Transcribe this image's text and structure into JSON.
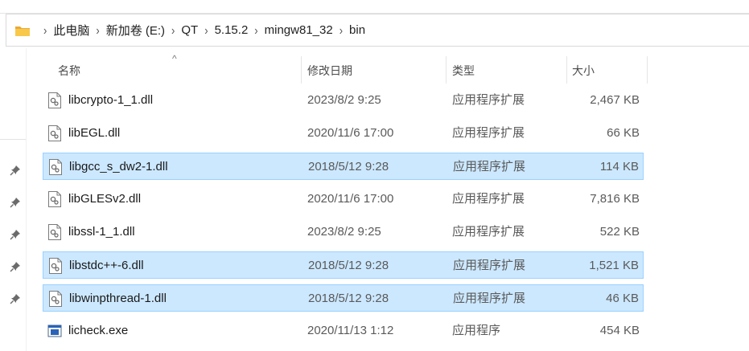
{
  "breadcrumb": [
    "此电脑",
    "新加卷 (E:)",
    "QT",
    "5.15.2",
    "mingw81_32",
    "bin"
  ],
  "columns": {
    "name": "名称",
    "date": "修改日期",
    "type": "类型",
    "size": "大小"
  },
  "files": [
    {
      "name": "libcrypto-1_1.dll",
      "date": "2023/8/2 9:25",
      "type": "应用程序扩展",
      "size": "2,467 KB",
      "icon": "dll-file-icon",
      "selected": false
    },
    {
      "name": "libEGL.dll",
      "date": "2020/11/6 17:00",
      "type": "应用程序扩展",
      "size": "66 KB",
      "icon": "dll-file-icon",
      "selected": false
    },
    {
      "name": "libgcc_s_dw2-1.dll",
      "date": "2018/5/12 9:28",
      "type": "应用程序扩展",
      "size": "114 KB",
      "icon": "dll-file-icon",
      "selected": true
    },
    {
      "name": "libGLESv2.dll",
      "date": "2020/11/6 17:00",
      "type": "应用程序扩展",
      "size": "7,816 KB",
      "icon": "dll-file-icon",
      "selected": false
    },
    {
      "name": "libssl-1_1.dll",
      "date": "2023/8/2 9:25",
      "type": "应用程序扩展",
      "size": "522 KB",
      "icon": "dll-file-icon",
      "selected": false
    },
    {
      "name": "libstdc++-6.dll",
      "date": "2018/5/12 9:28",
      "type": "应用程序扩展",
      "size": "1,521 KB",
      "icon": "dll-file-icon",
      "selected": true
    },
    {
      "name": "libwinpthread-1.dll",
      "date": "2018/5/12 9:28",
      "type": "应用程序扩展",
      "size": "46 KB",
      "icon": "dll-file-icon",
      "selected": true
    },
    {
      "name": "licheck.exe",
      "date": "2020/11/13 1:12",
      "type": "应用程序",
      "size": "454 KB",
      "icon": "exe-file-icon",
      "selected": false
    }
  ],
  "colors": {
    "selection_bg": "#cce8ff",
    "selection_border": "#99d1ff",
    "folder": "#f8c84a"
  },
  "icons": {
    "folder": "folder-icon",
    "chevron": "chevron-right-icon",
    "pin": "pin-icon",
    "sort": "sort-up-icon"
  }
}
